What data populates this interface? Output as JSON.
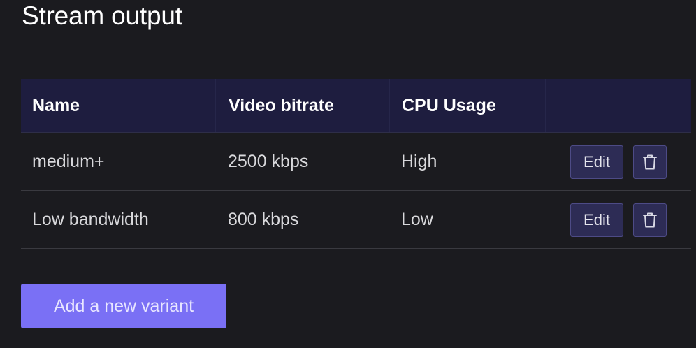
{
  "page": {
    "title": "Stream output"
  },
  "table": {
    "headers": [
      "Name",
      "Video bitrate",
      "CPU Usage",
      ""
    ],
    "rows": [
      {
        "name": "medium+",
        "bitrate": "2500 kbps",
        "cpu": "High",
        "edit_label": "Edit",
        "delete_icon": "trash-icon"
      },
      {
        "name": "Low bandwidth",
        "bitrate": "800 kbps",
        "cpu": "Low",
        "edit_label": "Edit",
        "delete_icon": "trash-icon"
      }
    ]
  },
  "actions": {
    "add_label": "Add a new variant"
  },
  "colors": {
    "background": "#1b1b1f",
    "header_bg": "#1e1d3f",
    "button_bg": "#2d2c55",
    "accent": "#7a70f5"
  }
}
